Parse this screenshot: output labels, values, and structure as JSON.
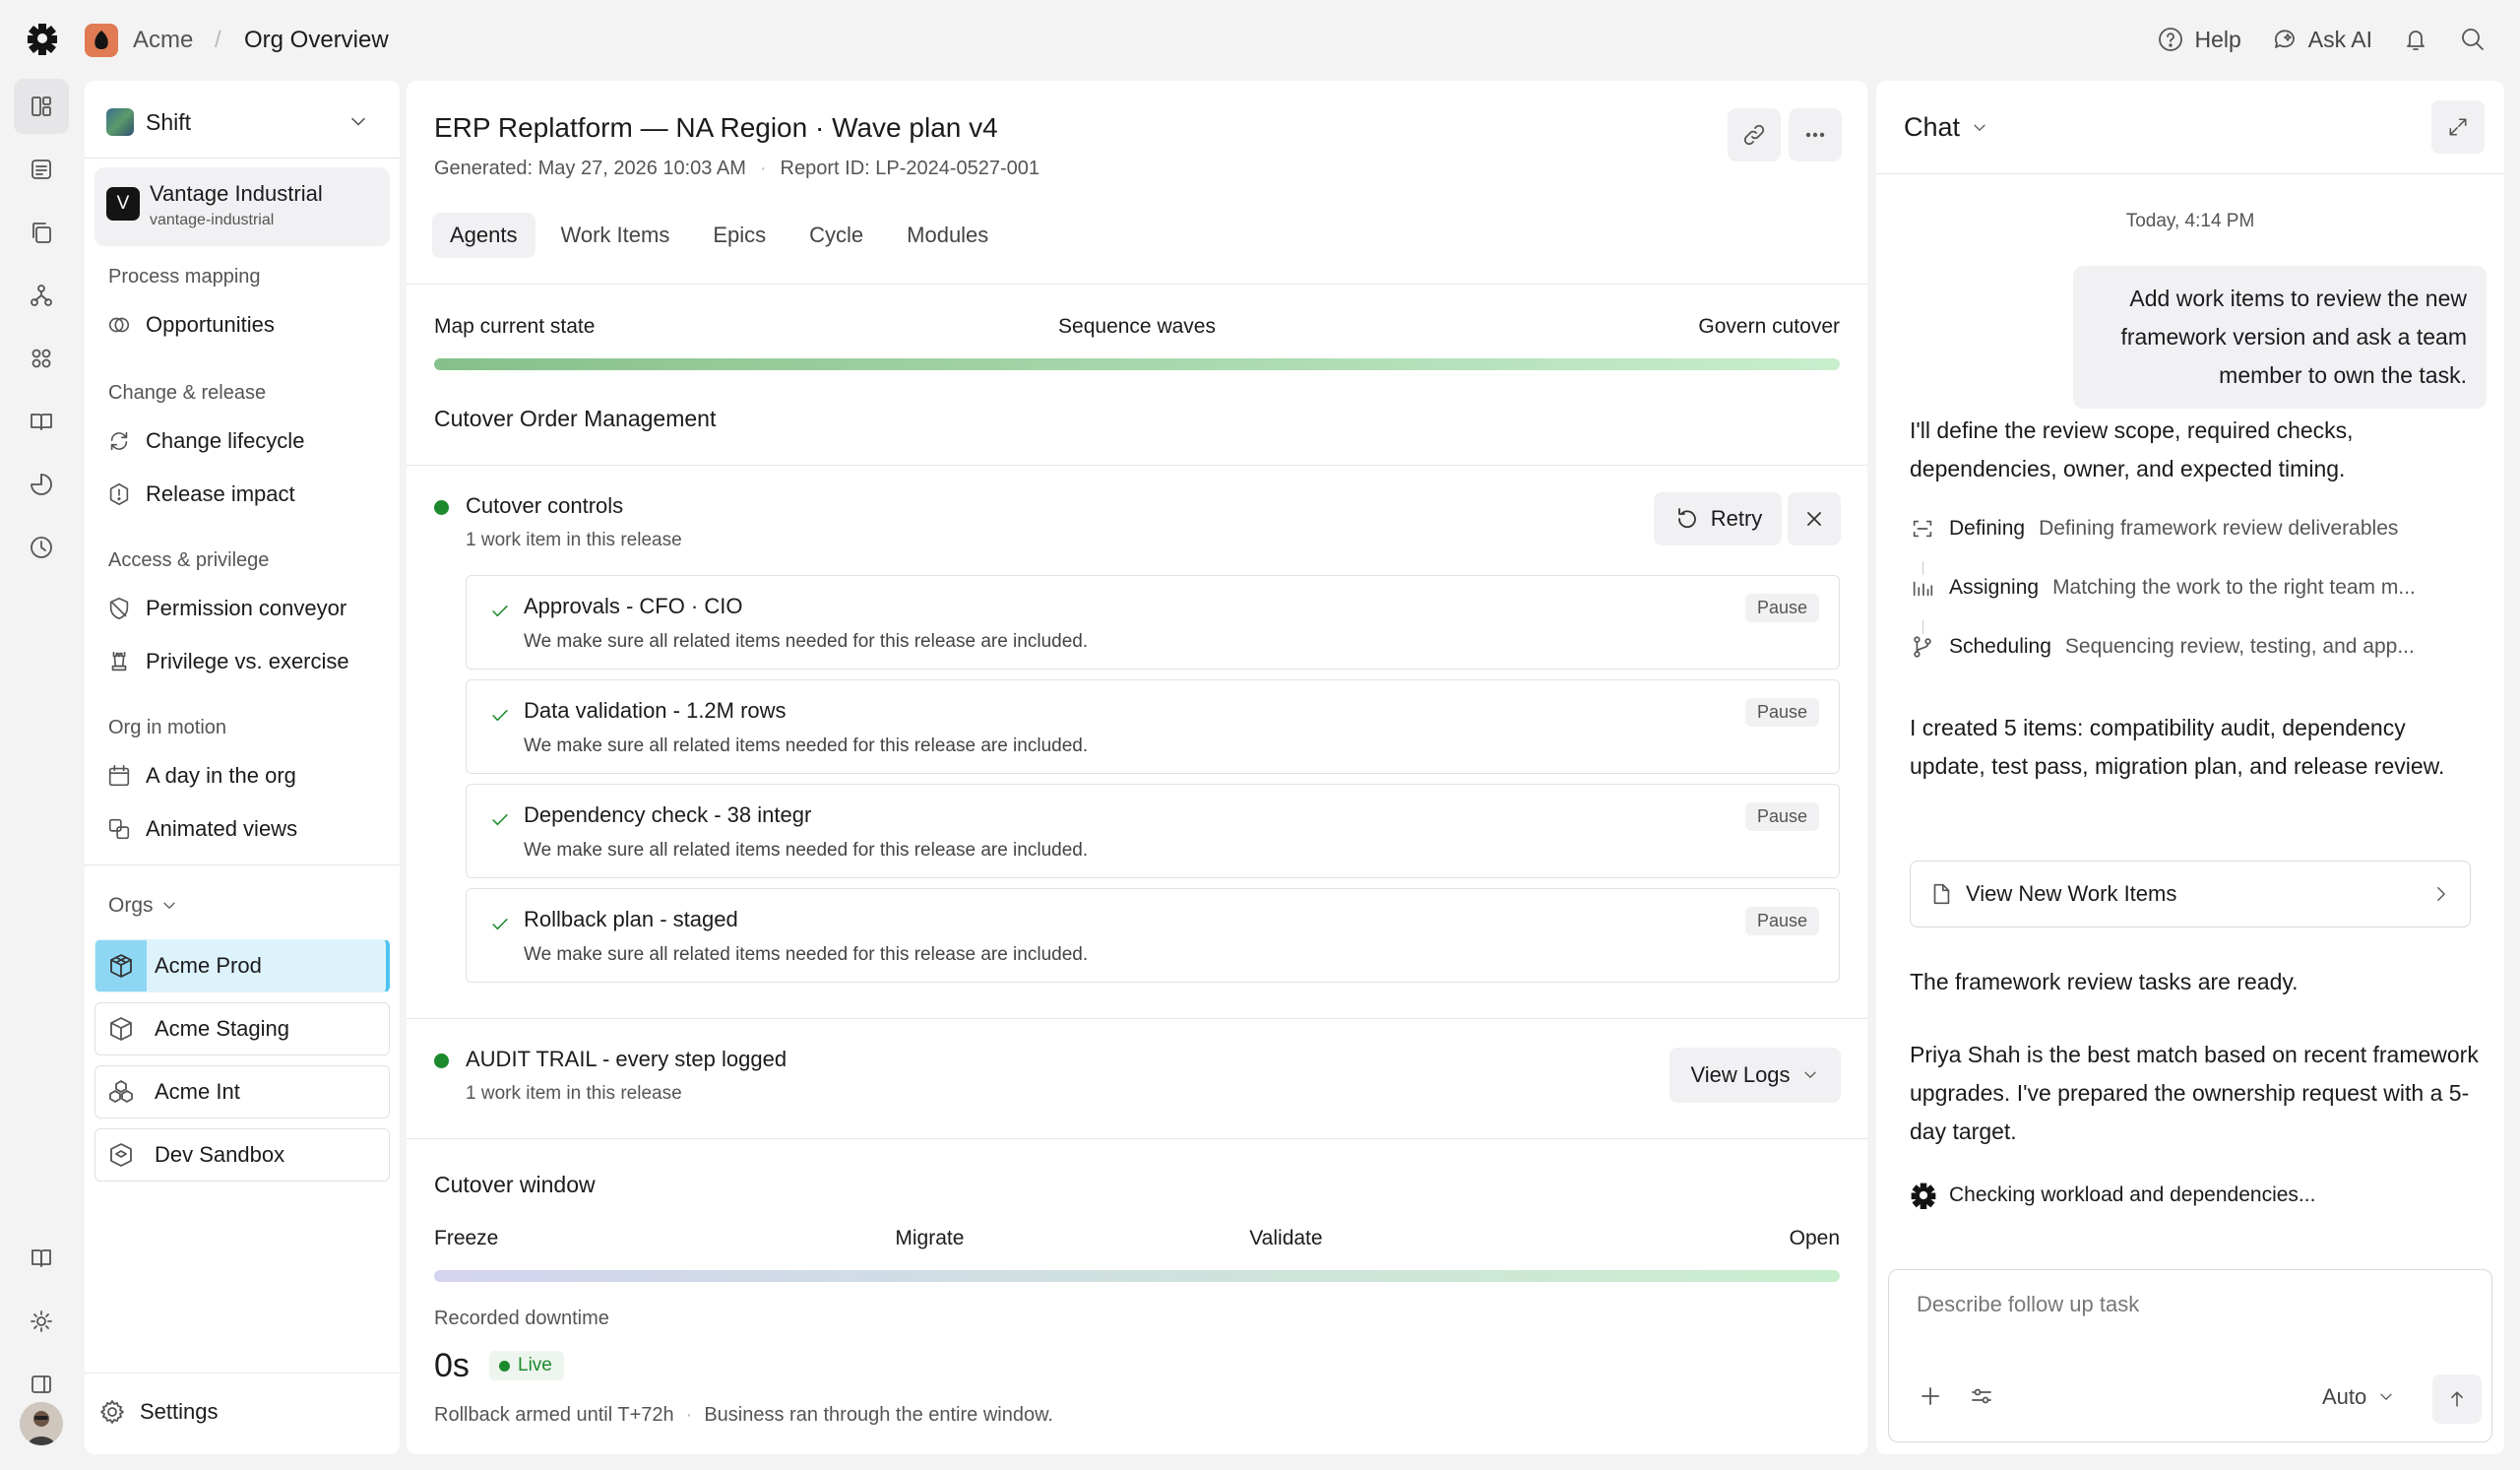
{
  "colors": {
    "accent": "#4fc3f0",
    "success": "#1c8a2c",
    "progress_start": "#86c08a",
    "progress_end": "#c9eecd",
    "window_start": "#d4d4f0",
    "window_end": "#c9eecd"
  },
  "topbar": {
    "org": "Acme",
    "separator": "/",
    "page": "Org Overview",
    "help": "Help",
    "ask_ai": "Ask AI",
    "icons": [
      "help-icon",
      "ask-ai-icon",
      "bell-icon",
      "search-icon"
    ]
  },
  "rail": {
    "icons": [
      "dashboard-icon",
      "document-icon",
      "copy-icon",
      "network-icon",
      "apps-icon",
      "book-icon",
      "pie-chart-icon",
      "clock-icon",
      "guide-icon",
      "sun-icon",
      "panel-icon"
    ]
  },
  "sidebar": {
    "workspace": "Shift",
    "org": {
      "letter": "V",
      "name": "Vantage Industrial",
      "slug": "vantage-industrial"
    },
    "sections": [
      {
        "label": "Process mapping",
        "items": [
          {
            "label": "Opportunities",
            "icon": "opportunities-icon"
          }
        ]
      },
      {
        "label": "Change & release",
        "items": [
          {
            "label": "Change lifecycle",
            "icon": "cycle-icon"
          },
          {
            "label": "Release impact",
            "icon": "alert-icon"
          }
        ]
      },
      {
        "label": "Access & privilege",
        "items": [
          {
            "label": "Permission conveyor",
            "icon": "shield-icon"
          },
          {
            "label": "Privilege vs. exercise",
            "icon": "chess-icon"
          }
        ]
      },
      {
        "label": "Org in motion",
        "items": [
          {
            "label": "A day in the org",
            "icon": "calendar-icon"
          },
          {
            "label": "Animated views",
            "icon": "layers-icon"
          }
        ]
      }
    ],
    "orgs_label": "Orgs",
    "orgs": [
      {
        "label": "Acme Prod",
        "selected": true
      },
      {
        "label": "Acme Staging",
        "selected": false
      },
      {
        "label": "Acme Int",
        "selected": false
      },
      {
        "label": "Dev Sandbox",
        "selected": false
      }
    ],
    "settings": "Settings"
  },
  "main": {
    "title": "ERP Replatform — NA Region · Wave plan v4",
    "generated": "Generated: May 27, 2026 10:03 AM",
    "meta_sep": "·",
    "report_id": "Report ID: LP-2024-0527-001",
    "tabs": [
      "Agents",
      "Work Items",
      "Epics",
      "Cycle",
      "Modules"
    ],
    "active_tab": "Agents",
    "phases": [
      "Map current state",
      "Sequence waves",
      "Govern cutover"
    ],
    "phase_progress": 1.0,
    "section_title": "Cutover Order Management",
    "controls": {
      "title": "Cutover controls",
      "sub": "1 work item in this release",
      "retry": "Retry",
      "tasks": [
        {
          "title": "Approvals - CFO · CIO",
          "desc": "We make sure all related items needed for this release are included.",
          "action": "Pause"
        },
        {
          "title": "Data validation - 1.2M rows",
          "desc": "We make sure all related items needed for this release are included.",
          "action": "Pause"
        },
        {
          "title": "Dependency check - 38 integr",
          "desc": "We make sure all related items needed for this release are included.",
          "action": "Pause"
        },
        {
          "title": "Rollback plan - staged",
          "desc": "We make sure all related items needed for this release are included.",
          "action": "Pause"
        }
      ]
    },
    "audit": {
      "title": "AUDIT TRAIL - every step logged",
      "sub": "1 work item in this release",
      "button": "View Logs"
    },
    "window": {
      "title": "Cutover window",
      "stages": [
        "Freeze",
        "Migrate",
        "Validate",
        "Open"
      ],
      "progress": 1.0,
      "downtime_label": "Recorded downtime",
      "downtime_value": "0s",
      "live": "Live",
      "footer_a": "Rollback armed until T+72h",
      "footer_sep": "·",
      "footer_b": "Business ran through the entire window."
    }
  },
  "chat": {
    "title": "Chat",
    "time": "Today, 4:14 PM",
    "user_message": "Add work items to review the new framework version and ask a team member to own the task.",
    "ai_intro": "I'll define the review scope, required checks, dependencies, owner, and expected timing.",
    "steps": [
      {
        "name": "Defining",
        "desc": "Defining framework review deliverables",
        "icon": "scan-icon"
      },
      {
        "name": "Assigning",
        "desc": "Matching the work to the right team m...",
        "icon": "bars-icon"
      },
      {
        "name": "Scheduling",
        "desc": "Sequencing review, testing, and app...",
        "icon": "branch-icon"
      }
    ],
    "ai_created": "I created 5 items: compatibility audit, dependency update, test pass, migration plan, and release review.",
    "view_button": "View New Work Items",
    "ai_ready": "The framework review tasks are ready.",
    "ai_owner": "Priya Shah is the best match based on recent framework upgrades. I've prepared the ownership request with a 5-day target.",
    "checking": "Checking workload and dependencies...",
    "composer_placeholder": "Describe follow up task",
    "model": "Auto"
  }
}
